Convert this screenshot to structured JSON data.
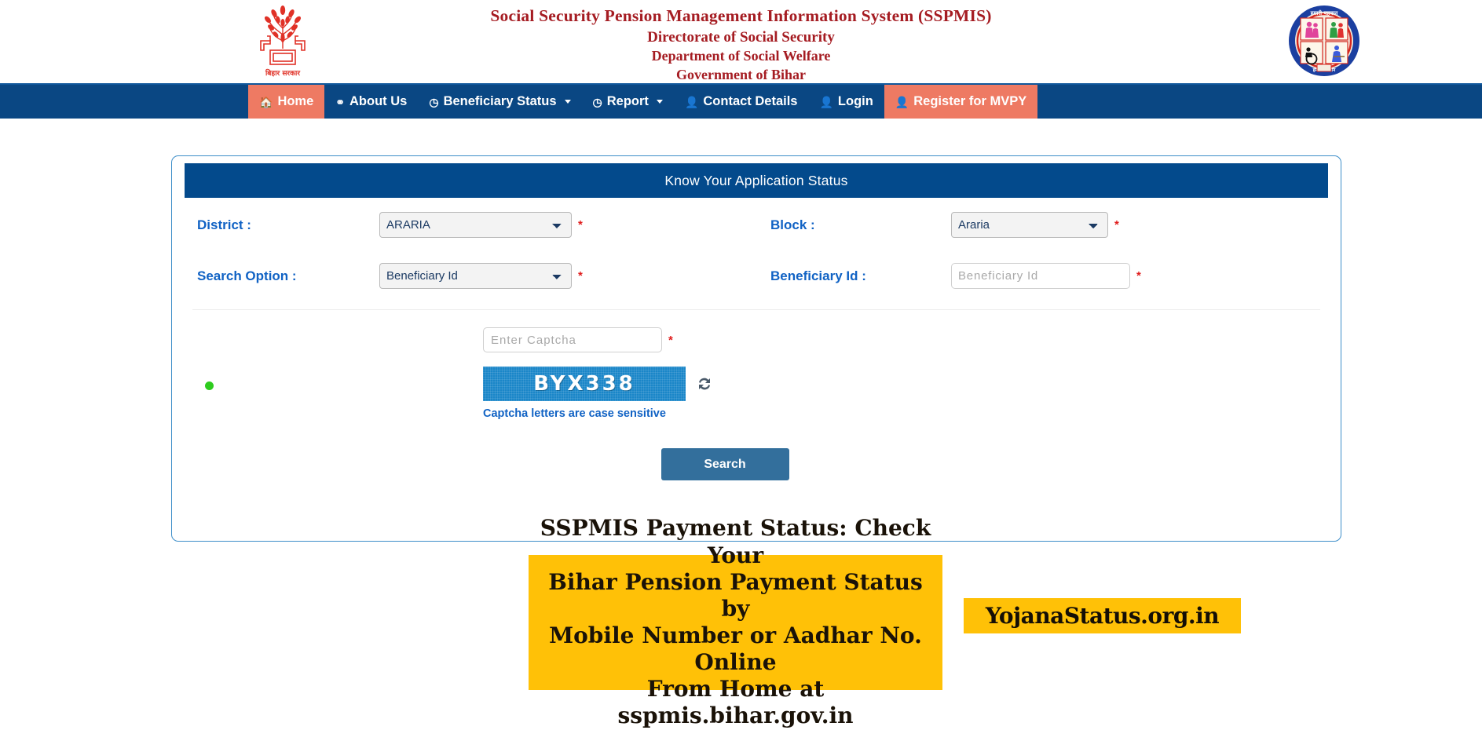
{
  "header": {
    "title_line1": "Social Security Pension Management Information System (SSPMIS)",
    "title_line2": "Directorate of Social Security",
    "title_line3": "Department of Social Welfare",
    "title_line4": "Government of Bihar",
    "emblem_left_name": "bihar-government-emblem",
    "emblem_left_caption": "बिहार सरकार",
    "emblem_right_name": "social-welfare-department-logo",
    "title_color": "#a51c22"
  },
  "nav": {
    "background": "#0a4783",
    "active_color": "#ee7a63",
    "items": [
      {
        "label": "Home",
        "icon": "home-icon",
        "state": "active",
        "has_caret": false
      },
      {
        "label": "About Us",
        "icon": "info-group-icon",
        "state": "normal",
        "has_caret": false
      },
      {
        "label": "Beneficiary Status",
        "icon": "clock-icon",
        "state": "normal",
        "has_caret": true
      },
      {
        "label": "Report",
        "icon": "clock-icon",
        "state": "normal",
        "has_caret": true
      },
      {
        "label": "Contact Details",
        "icon": "user-icon",
        "state": "normal",
        "has_caret": false
      },
      {
        "label": "Login",
        "icon": "user-icon",
        "state": "normal",
        "has_caret": false
      },
      {
        "label": "Register for MVPY",
        "icon": "user-icon",
        "state": "cta",
        "has_caret": false
      }
    ]
  },
  "panel": {
    "heading": "Know Your Application Status",
    "heading_background": "#034a8c",
    "border_color": "#3d8ec9"
  },
  "form": {
    "district": {
      "label": "District  :",
      "value": "ARARIA",
      "required_mark": "*"
    },
    "block": {
      "label": "Block  :",
      "value": "Araria",
      "required_mark": "*"
    },
    "search_option": {
      "label": "Search Option  :",
      "value": "Beneficiary Id",
      "required_mark": "*"
    },
    "beneficiary_id": {
      "label": "Beneficiary Id :",
      "value": "",
      "placeholder": "Beneficiary Id",
      "required_mark": "*"
    }
  },
  "captcha": {
    "input_value": "",
    "input_placeholder": "Enter Captcha",
    "required_mark": "*",
    "code": "BYX338",
    "image_background": "#1a86c8",
    "note": "Captcha letters are case sensitive",
    "refresh_icon": "refresh-icon",
    "status_dot": "green-status-dot"
  },
  "actions": {
    "search_label": "Search",
    "search_color": "#336f9c"
  },
  "banners": {
    "promo": {
      "line1": "SSPMIS Payment Status: Check Your",
      "line2": "Bihar Pension Payment Status by",
      "line3": "Mobile Number or Aadhar No. Online",
      "line4": "From Home at sspmis.bihar.gov.in",
      "background": "#ffc107"
    },
    "watermark": {
      "text": "YojanaStatus.org.in",
      "background": "#ffc107"
    }
  }
}
